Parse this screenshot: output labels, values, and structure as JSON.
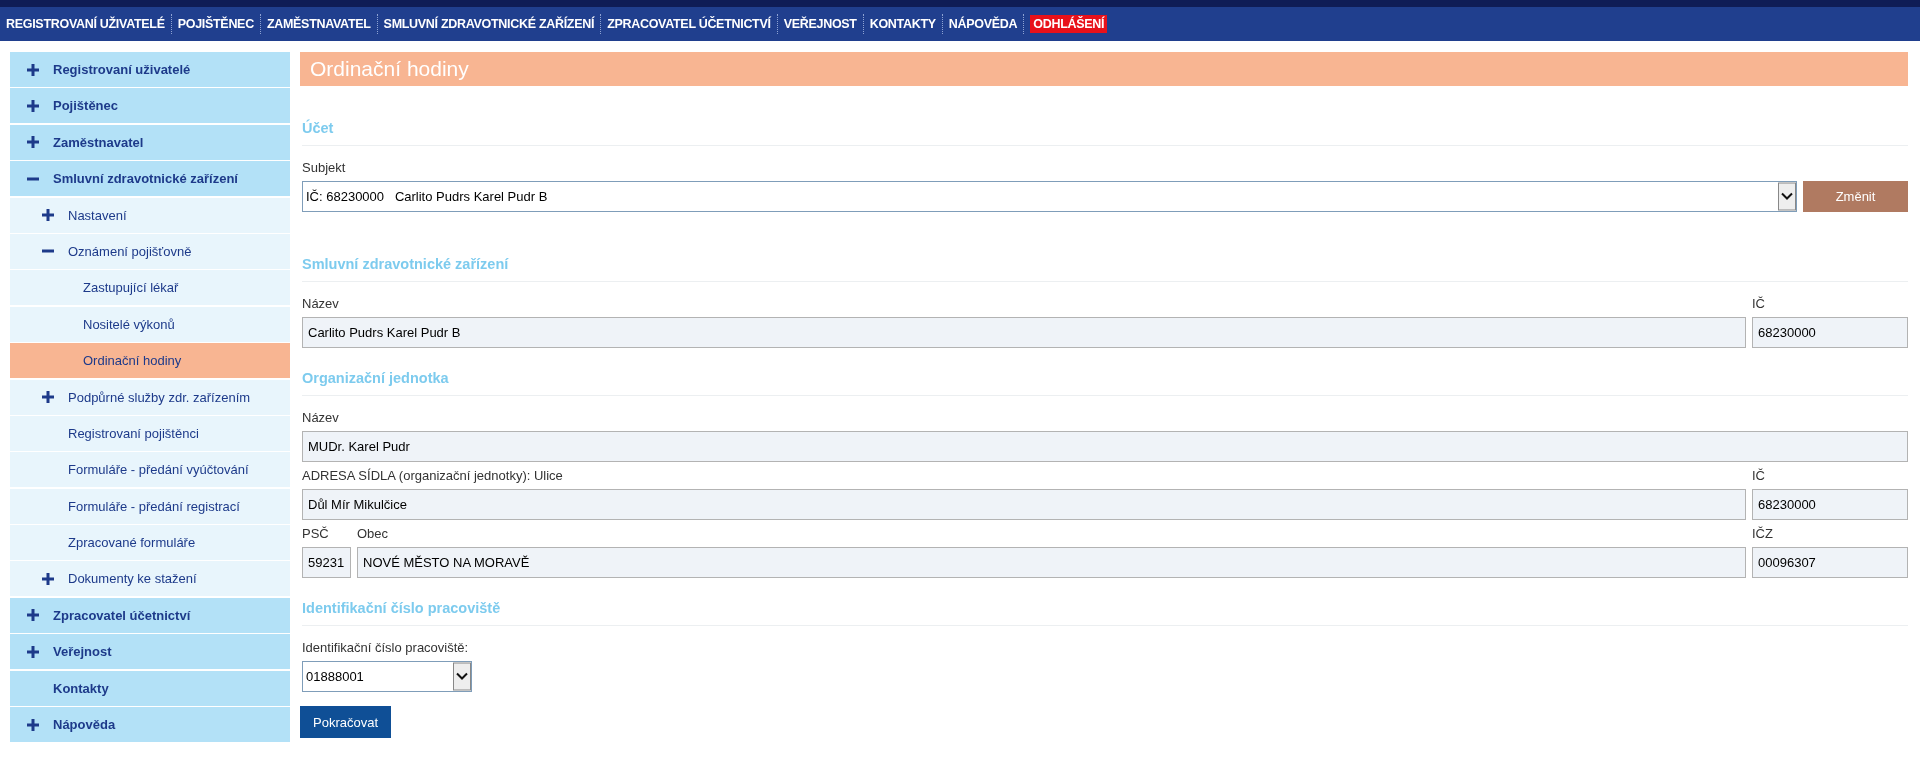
{
  "top_nav": [
    {
      "label": "REGISTROVANÍ UŽIVATELÉ",
      "kind": "link"
    },
    {
      "label": "POJIŠTĚNEC",
      "kind": "link"
    },
    {
      "label": "ZAMĚSTNAVATEL",
      "kind": "link"
    },
    {
      "label": "SMLUVNÍ ZDRAVOTNICKÉ ZAŘÍZENÍ",
      "kind": "link"
    },
    {
      "label": "ZPRACOVATEL ÚČETNICTVÍ",
      "kind": "link"
    },
    {
      "label": "VEŘEJNOST",
      "kind": "link"
    },
    {
      "label": "KONTAKTY",
      "kind": "link"
    },
    {
      "label": "NÁPOVĚDA",
      "kind": "link"
    },
    {
      "label": "ODHLÁŠENÍ",
      "kind": "logout"
    }
  ],
  "sidebar": {
    "items": [
      {
        "label": "Registrovaní uživatelé",
        "expanded": false,
        "selected": false
      },
      {
        "label": "Pojištěnec",
        "expanded": false,
        "selected": false
      },
      {
        "label": "Zaměstnavatel",
        "expanded": false,
        "selected": false
      },
      {
        "label": "Smluvní zdravotnické zařízení",
        "expanded": true,
        "selected": false,
        "children": [
          {
            "label": "Nastavení",
            "expanded": false,
            "selected": false
          },
          {
            "label": "Oznámení pojišťovně",
            "expanded": true,
            "selected": false,
            "children": [
              {
                "label": "Zastupující lékař",
                "selected": false
              },
              {
                "label": "Nositelé výkonů",
                "selected": false
              },
              {
                "label": "Ordinační hodiny",
                "selected": true
              }
            ]
          },
          {
            "label": "Podpůrné služby zdr. zařízením",
            "expanded": false,
            "selected": false
          },
          {
            "label": "Registrovaní pojištěnci",
            "selected": false
          },
          {
            "label": "Formuláře - předání vyúčtování",
            "selected": false
          },
          {
            "label": "Formuláře - předání registrací",
            "selected": false
          },
          {
            "label": "Zpracované formuláře",
            "selected": false
          },
          {
            "label": "Dokumenty ke stažení",
            "expanded": false,
            "selected": false
          }
        ]
      },
      {
        "label": "Zpracovatel účetnictví",
        "expanded": false,
        "selected": false
      },
      {
        "label": "Veřejnost",
        "expanded": false,
        "selected": false
      },
      {
        "label": "Kontakty",
        "selected": false
      },
      {
        "label": "Nápověda",
        "expanded": false,
        "selected": false
      }
    ]
  },
  "page_title": "Ordinační hodiny",
  "sections": [
    {
      "heading": "Účet",
      "rows": [
        {
          "fields": [
            {
              "label": "Subjekt",
              "value": "IČ: 68230000   Carlito Pudrs Karel Pudr B",
              "kind": "select"
            }
          ],
          "button": "Změnit"
        }
      ]
    },
    {
      "heading": "Smluvní zdravotnické zařízení",
      "rows": [
        {
          "fields": [
            {
              "label": "Název",
              "value": "Carlito Pudrs Karel Pudr B",
              "kind": "text"
            },
            {
              "label": "IČ",
              "value": "68230000",
              "kind": "text-id"
            }
          ]
        }
      ]
    },
    {
      "heading": "Organizační jednotka",
      "rows": [
        {
          "fields": [
            {
              "label": "Název",
              "value": "MUDr. Karel Pudr",
              "kind": "text"
            }
          ]
        },
        {
          "fields": [
            {
              "label": "ADRESA SÍDLA (organizační jednotky): Ulice",
              "value": "Důl Mír Mikulčice",
              "kind": "text"
            },
            {
              "label": "IČ",
              "value": "68230000",
              "kind": "text-id"
            }
          ]
        },
        {
          "fields": [
            {
              "label": "PSČ",
              "value": "59231",
              "kind": "text-postcode"
            },
            {
              "label": "Obec",
              "value": "NOVÉ MĚSTO NA MORAVĚ",
              "kind": "text"
            },
            {
              "label": "IČZ",
              "value": "00096307",
              "kind": "text-id"
            }
          ]
        }
      ]
    },
    {
      "heading": "Identifikační číslo pracoviště",
      "rows": [
        {
          "fields": [
            {
              "label": "Identifikační číslo pracoviště:",
              "value": "01888001",
              "kind": "select-short"
            }
          ]
        }
      ]
    }
  ],
  "submit_button": "Pokračovat"
}
